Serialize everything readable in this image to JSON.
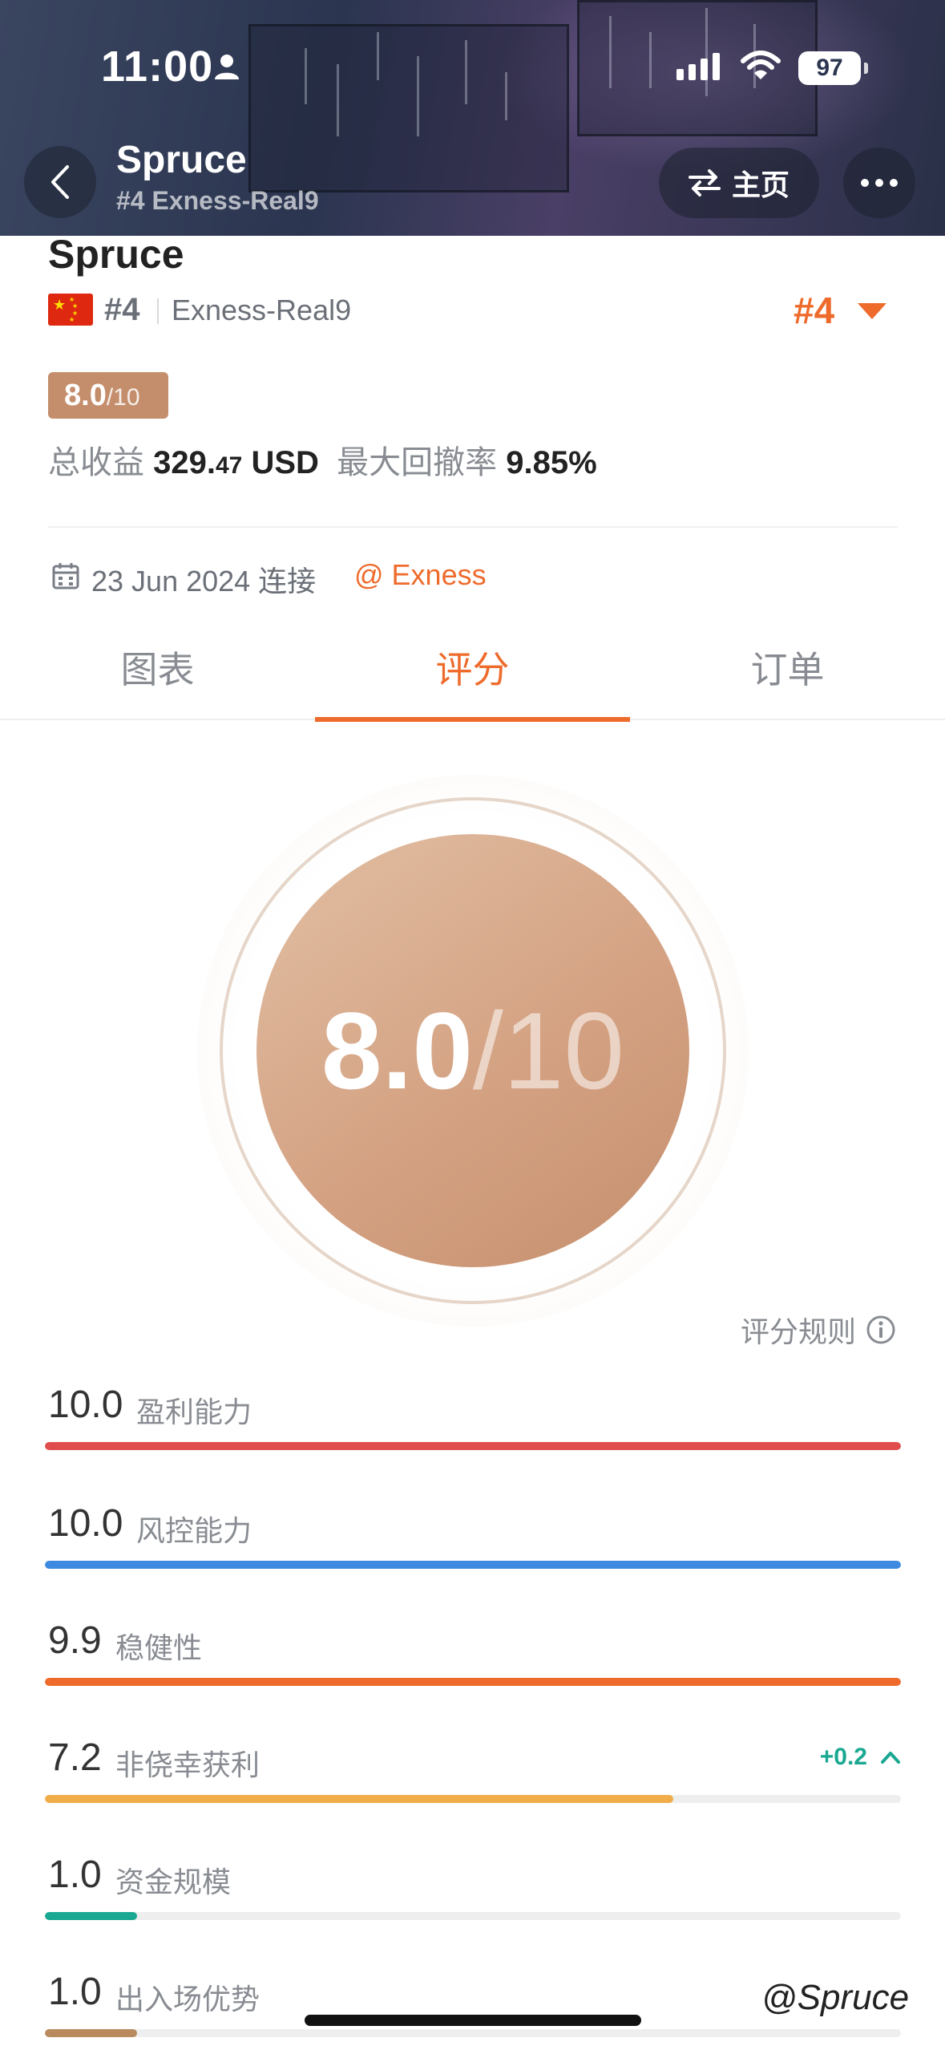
{
  "status_bar": {
    "time": "11:00",
    "battery": "97"
  },
  "nav": {
    "title": "Spruce",
    "subtitle": "#4 Exness-Real9",
    "home_label": "主页"
  },
  "profile": {
    "name": "Spruce",
    "rank": "#4",
    "account": "Exness-Real9",
    "rank_big": "#4",
    "score": "8.0",
    "score_den": "/10",
    "total_profit_label": "总收益",
    "total_profit_main": "329.",
    "total_profit_cents": "47",
    "total_profit_unit": "USD",
    "max_drawdown_label": "最大回撤率",
    "max_drawdown_value": "9.85%",
    "connect_date": "23 Jun 2024 连接",
    "broker": "@ Exness"
  },
  "tabs": [
    {
      "label": "图表",
      "active": false
    },
    {
      "label": "评分",
      "active": true
    },
    {
      "label": "订单",
      "active": false
    }
  ],
  "score_circle": {
    "score": "8.0",
    "den": "/10"
  },
  "rules_label": "评分规则",
  "metrics": [
    {
      "value": "10.0",
      "label": "盈利能力",
      "fraction": 1.0,
      "color": "#e04d4d"
    },
    {
      "value": "10.0",
      "label": "风控能力",
      "fraction": 1.0,
      "color": "#3d8ae0"
    },
    {
      "value": "9.9",
      "label": "稳健性",
      "fraction": 1.0,
      "color": "#ee6b2c"
    },
    {
      "value": "7.2",
      "label": "非侥幸获利",
      "fraction": 0.734,
      "color": "#f0ad4a",
      "delta": "+0.2"
    },
    {
      "value": "1.0",
      "label": "资金规模",
      "fraction": 0.108,
      "color": "#1aa892"
    },
    {
      "value": "1.0",
      "label": "出入场优势",
      "fraction": 0.108,
      "color": "#b98a5e"
    }
  ],
  "watermark": "@Spruce"
}
